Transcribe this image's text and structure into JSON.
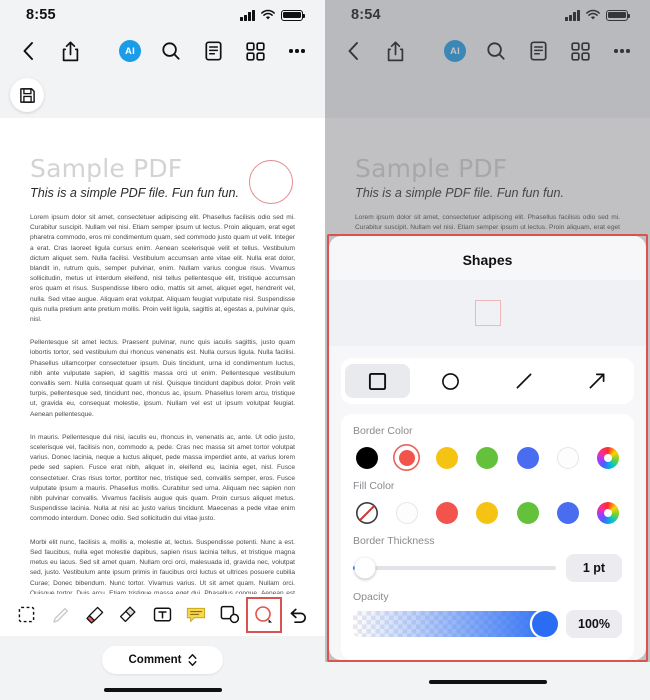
{
  "left": {
    "status": {
      "time": "8:55",
      "signal_icon": "cellular-signal-icon",
      "wifi_icon": "wifi-icon",
      "battery_icon": "battery-icon"
    },
    "nav": {
      "back_icon": "chevron-left-icon",
      "share_icon": "share-icon",
      "ai_label": "AI",
      "search_icon": "search-icon",
      "outline_icon": "document-outline-icon",
      "thumbnails_icon": "grid-thumbnails-icon",
      "more_icon": "more-options-icon"
    },
    "save_icon": "save-floppy-icon",
    "document": {
      "title": "Sample PDF",
      "subtitle": "This is a simple PDF file. Fun fun fun.",
      "paragraph1": "Lorem ipsum dolor sit amet, consectetuer adipiscing elit. Phasellus facilisis odio sed mi. Curabitur suscipit. Nullam vel nisi. Etiam semper ipsum ut lectus. Proin aliquam, erat eget pharetra commodo, eros mi condimentum quam, sed commodo justo quam ut velit. Integer a erat. Cras laoreet ligula cursus enim. Aenean scelerisque velit et tellus. Vestibulum dictum aliquet sem. Nulla facilisi. Vestibulum accumsan ante vitae elit. Nulla erat dolor, blandit in, rutrum quis, semper pulvinar, enim. Nullam varius congue risus. Vivamus sollicitudin, metus ut interdum eleifend, nisl tellus pellentesque elit, tristique accumsan eros quam et risus. Suspendisse libero odio, mattis sit amet, aliquet eget, hendrerit vel, nulla. Sed vitae augue. Aliquam erat volutpat. Aliquam feugiat vulputate nisl. Suspendisse quis nulla pretium ante pretium mollis. Proin velit ligula, sagittis at, egestas a, pulvinar quis, nisl.",
      "paragraph2": "Pellentesque sit amet lectus. Praesent pulvinar, nunc quis iaculis sagittis, justo quam lobortis tortor, sed vestibulum dui rhoncus venenatis est. Nulla cursus ligula. Nulla facilisi. Phasellus ullamcorper consectetuer ipsum. Duis tincidunt, urna id condimentum luctus, nibh ante vulputate sapien, id sagittis massa orci ut enim. Pellentesque vestibulum convallis sem. Nulla consequat quam ut nisl. Quisque tincidunt dapibus dolor. Proin velit turpis, pellentesque sed, tincidunt nec, rhoncus ac, ipsum. Phasellus lorem arcu, tristique ut, gravida eu, consequat molestie, ipsum. Nullam vel est ut ipsum volutpat feugiat. Aenean pellentesque.",
      "paragraph3": "In mauris. Pellentesque dui nisi, iaculis eu, rhoncus in, venenatis ac, ante. Ut odio justo, scelerisque vel, facilisis non, commodo a, pede. Cras nec massa sit amet tortor volutpat varius. Donec lacinia, neque a luctus aliquet, pede massa imperdiet ante, at varius lorem pede sed sapien. Fusce erat nibh, aliquet in, eleifend eu, lacinia eget, nisl. Fusce consectetuer. Cras risus tortor, porttitor nec, tristique sed, convallis semper, eros. Fusce vulputate ipsum a mauris. Phasellus mollis. Curabitur sed urna. Aliquam nec sapien non nibh pulvinar convallis. Vivamus facilisis augue quis quam. Proin cursus aliquet metus. Suspendisse lacinia. Nulla at nisi ac justo varius tincidunt. Maecenas a pede vitae enim commodo interdum. Donec odio. Sed sollicitudin dui vitae justo.",
      "paragraph4": "Morbi elit nunc, facilisis a, mollis a, molestie at, lectus. Suspendisse potenti. Nunc a est. Sed faucibus, nulla eget molestie dapibus, sapien risus lacinia tellus, et tristique magna metus eu lacus. Sed sit amet quam. Nullam orci orci, malesuada id, gravida nec, volutpat sed, justo. Vestibulum ante ipsum primis in faucibus orci luctus et ultrices posuere cubilia Curae; Donec bibendum. Nunc tortor. Vivamus varius. Ut sit amet quam. Nullam orci. Quisque tortor. Duis arcu. Etiam tristique massa eget dui. Phasellus congue. Aenean est erat, tincidunt eget, venenatis quis, commodo at, quam."
    },
    "annotation_shape": "circle-annotation",
    "toolbar": {
      "select_icon": "marquee-select-icon",
      "pen_icon": "pen-icon",
      "highlighter_icon": "highlighter-icon",
      "eraser_icon": "eraser-icon",
      "textbox_icon": "text-box-icon",
      "note_icon": "sticky-note-icon",
      "stamp_icon": "shapes-stamp-icon",
      "shapes_icon": "shapes-tool-icon",
      "undo_icon": "undo-icon"
    },
    "comment_label": "Comment",
    "comment_chevron_icon": "chevron-up-down-icon"
  },
  "right": {
    "status": {
      "time": "8:54",
      "signal_icon": "cellular-signal-icon",
      "wifi_icon": "wifi-icon",
      "battery_icon": "battery-icon"
    },
    "nav": {
      "back_icon": "chevron-left-icon",
      "share_icon": "share-icon",
      "ai_label": "AI",
      "search_icon": "search-icon",
      "outline_icon": "document-outline-icon",
      "thumbnails_icon": "grid-thumbnails-icon",
      "more_icon": "more-options-icon"
    },
    "document": {
      "title": "Sample PDF",
      "subtitle": "This is a simple PDF file. Fun fun fun.",
      "paragraph1": "Lorem ipsum dolor sit amet, consectetuer adipiscing elit. Phasellus facilisis odio sed mi. Curabitur suscipit. Nullam vel nisi. Etiam semper ipsum ut lectus. Proin aliquam, erat eget pharetra commodo, eros mi condimentum quam, sed commodo justo quam ut velit. Integer a erat. Cras laoreet ligula cursus enim."
    },
    "sheet": {
      "title": "Shapes",
      "preview_shape": "square-preview",
      "shape_tools": [
        {
          "name": "square-shape-tool",
          "icon": "square-icon",
          "selected": true
        },
        {
          "name": "circle-shape-tool",
          "icon": "circle-icon",
          "selected": false
        },
        {
          "name": "line-shape-tool",
          "icon": "line-icon",
          "selected": false
        },
        {
          "name": "arrow-shape-tool",
          "icon": "arrow-icon",
          "selected": false
        }
      ],
      "border_color_label": "Border Color",
      "border_colors": [
        {
          "name": "black",
          "hex": "#000000",
          "selected": false
        },
        {
          "name": "red",
          "hex": "#f2534d",
          "selected": true
        },
        {
          "name": "yellow",
          "hex": "#f5c311",
          "selected": false
        },
        {
          "name": "green",
          "hex": "#63c13c",
          "selected": false
        },
        {
          "name": "blue",
          "hex": "#4a6cf0",
          "selected": false
        },
        {
          "name": "white",
          "hex": "#fdfdfd",
          "selected": false
        },
        {
          "name": "custom-color-wheel",
          "hex": "wheel",
          "selected": false
        }
      ],
      "fill_color_label": "Fill Color",
      "fill_colors": [
        {
          "name": "none",
          "hex": "none",
          "selected": false
        },
        {
          "name": "white",
          "hex": "#fdfdfd",
          "selected": false
        },
        {
          "name": "red",
          "hex": "#f2534d",
          "selected": false
        },
        {
          "name": "yellow",
          "hex": "#f5c311",
          "selected": false
        },
        {
          "name": "green",
          "hex": "#63c13c",
          "selected": false
        },
        {
          "name": "blue",
          "hex": "#4a6cf0",
          "selected": false
        },
        {
          "name": "custom-color-wheel",
          "hex": "wheel",
          "selected": false
        }
      ],
      "border_thickness_label": "Border Thickness",
      "border_thickness_value": "1 pt",
      "border_thickness_percent": 6,
      "opacity_label": "Opacity",
      "opacity_value": "100%",
      "opacity_percent": 100
    },
    "home_indicator": "home-indicator"
  }
}
